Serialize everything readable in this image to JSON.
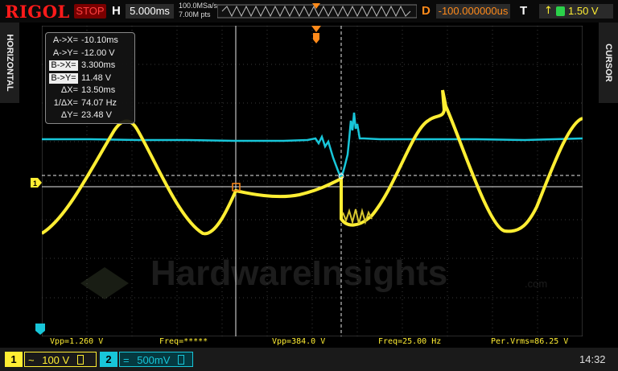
{
  "top": {
    "brand": "RIGOL",
    "run_state": "STOP",
    "h_label": "H",
    "timebase": "5.000ms",
    "sample_rate": "100.0MSa/s",
    "memory_depth": "7.00M pts",
    "d_label": "D",
    "delay": "-100.000000us",
    "t_label": "T",
    "trigger_level": "1.50 V",
    "trigger_source_color": "#2bd14a"
  },
  "side": {
    "left_tab": "HORIZONTAL",
    "right_tab": "CURSOR"
  },
  "cursor": {
    "rows": [
      {
        "key": "A->X=",
        "value": "-10.10ms",
        "inverted": false
      },
      {
        "key": "A->Y=",
        "value": "-12.00 V",
        "inverted": false
      },
      {
        "key": "B->X=",
        "value": "3.300ms",
        "inverted": true
      },
      {
        "key": "B->Y=",
        "value": "11.48 V",
        "inverted": true
      },
      {
        "key": "ΔX=",
        "value": "13.50ms",
        "inverted": false
      },
      {
        "key": "1/ΔX=",
        "value": "74.07 Hz",
        "inverted": false
      },
      {
        "key": "ΔY=",
        "value": "23.48 V",
        "inverted": false
      }
    ]
  },
  "watermark": {
    "text": "HardwareInsights",
    "suffix": ".com"
  },
  "measurements": {
    "vpp1": "Vpp=1.260 V",
    "freq1": "Freq=*****",
    "vpp2": "Vpp=384.0 V",
    "freq2": "Freq=25.00 Hz",
    "vrms": "Per.Vrms=86.25 V"
  },
  "channels": {
    "ch1": {
      "number": "1",
      "coupling": "~",
      "scale": "100 V",
      "color": "#ffee33"
    },
    "ch2": {
      "number": "2",
      "coupling": "=",
      "scale": "500mV",
      "color": "#18c6d9"
    }
  },
  "clock": "14:32",
  "colors": {
    "ch1": "#ffee33",
    "ch2": "#18c6d9",
    "trigger": "#ff8a1a",
    "stop": "#ff4040"
  }
}
